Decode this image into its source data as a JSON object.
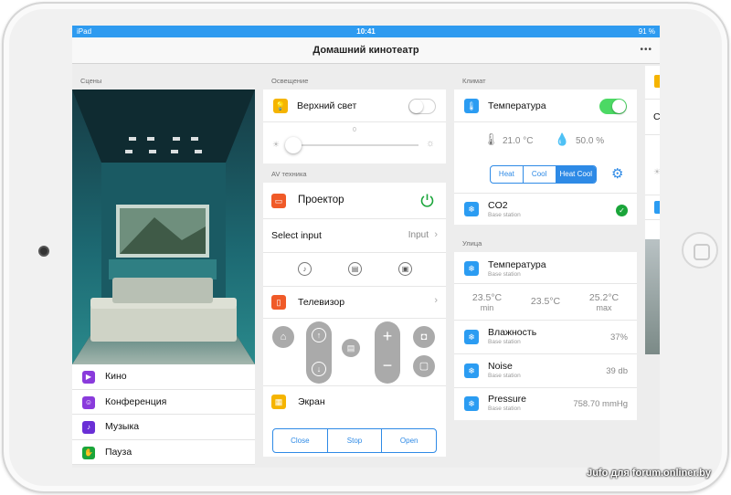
{
  "statusbar": {
    "device": "iPad",
    "time": "10:41",
    "battery": "91 %"
  },
  "navbar": {
    "title": "Домашний кинотеатр",
    "more": "•••"
  },
  "scenes": {
    "section_label": "Сцены",
    "items": [
      {
        "label": "Кино",
        "icon": "film-icon",
        "color": "#8a3bdc"
      },
      {
        "label": "Конференция",
        "icon": "people-icon",
        "color": "#8a3bdc"
      },
      {
        "label": "Музыка",
        "icon": "music-icon",
        "color": "#6a2fd6"
      },
      {
        "label": "Пауза",
        "icon": "hand-icon",
        "color": "#1aa53a"
      }
    ]
  },
  "lighting": {
    "section_label": "Освещение",
    "overhead_label": "Верхний свет",
    "overhead_on": false,
    "slider_value": "0",
    "slider_level": 0.05
  },
  "av": {
    "section_label": "AV техника",
    "projector_label": "Проектор",
    "select_input_label": "Select input",
    "input_value": "Input",
    "tv_label": "Телевизор",
    "screen_label": "Экран",
    "screen_buttons": [
      "Close",
      "Stop",
      "Open"
    ]
  },
  "climate": {
    "section_label": "Климат",
    "temperature_label": "Температура",
    "temperature_on": true,
    "indoor_temp": "21.0 °C",
    "indoor_humidity": "50.0 %",
    "modes": [
      "Heat",
      "Cool",
      "Heat Cool"
    ],
    "selected_mode": "Heat Cool",
    "co2_label": "CO2",
    "co2_sub": "Base station"
  },
  "outdoor": {
    "section_label": "Улица",
    "temperature_label": "Температура",
    "temperature_sub": "Base station",
    "temp_min": "23.5°C",
    "temp_min_label": "min",
    "temp_current": "23.5°C",
    "temp_max": "25.2°C",
    "temp_max_label": "max",
    "humidity_label": "Влажность",
    "humidity_sub": "Base station",
    "humidity_value": "37%",
    "noise_label": "Noise",
    "noise_sub": "Base station",
    "noise_value": "39 db",
    "pressure_label": "Pressure",
    "pressure_sub": "Base station",
    "pressure_value": "758.70 mmHg"
  },
  "peek_column": {
    "letter": "C"
  },
  "watermark": "Jufo для forum.onliner.by",
  "colors": {
    "accent": "#2b9cf2",
    "toggle_on": "#4cd964",
    "power_green": "#1aa53a",
    "light_yellow": "#f5b400",
    "projector_orange": "#f05a28"
  }
}
